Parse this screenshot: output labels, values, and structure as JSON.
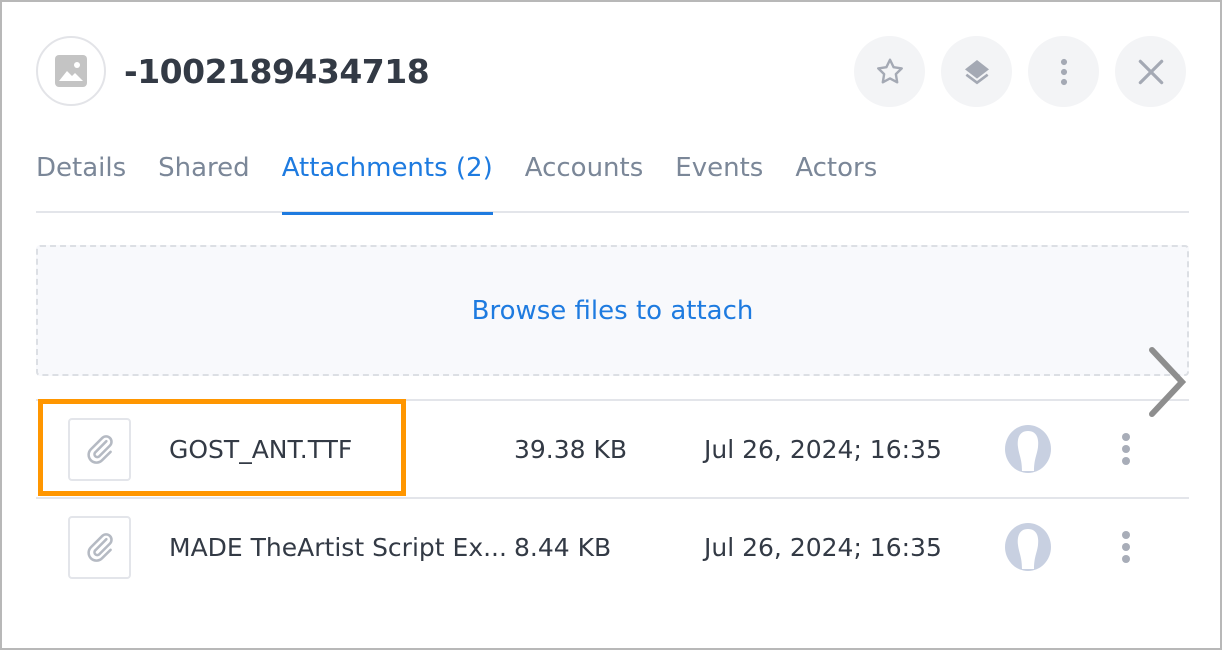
{
  "header": {
    "title": "-1002189434718",
    "avatar_icon": "image-icon"
  },
  "actions": [
    {
      "name": "favorite",
      "icon": "star-icon"
    },
    {
      "name": "layers",
      "icon": "layers-icon"
    },
    {
      "name": "more",
      "icon": "more-vertical-icon"
    },
    {
      "name": "close",
      "icon": "close-icon"
    }
  ],
  "tabs": [
    {
      "label": "Details",
      "active": false
    },
    {
      "label": "Shared",
      "active": false
    },
    {
      "label": "Attachments (2)",
      "active": true
    },
    {
      "label": "Accounts",
      "active": false
    },
    {
      "label": "Events",
      "active": false
    },
    {
      "label": "Actors",
      "active": false
    }
  ],
  "dropzone": {
    "label": "Browse files to attach"
  },
  "attachments": [
    {
      "name": "GOST_ANT.TTF",
      "size": "39.38 KB",
      "date": "Jul 26, 2024; 16:35",
      "icon": "paperclip-icon"
    },
    {
      "name": "MADE TheArtist Script Ex...",
      "size": "8.44 KB",
      "date": "Jul 26, 2024; 16:35",
      "icon": "paperclip-icon"
    }
  ],
  "colors": {
    "accent": "#1e7be0",
    "highlight": "#ff9600",
    "muted": "#7b8798"
  }
}
